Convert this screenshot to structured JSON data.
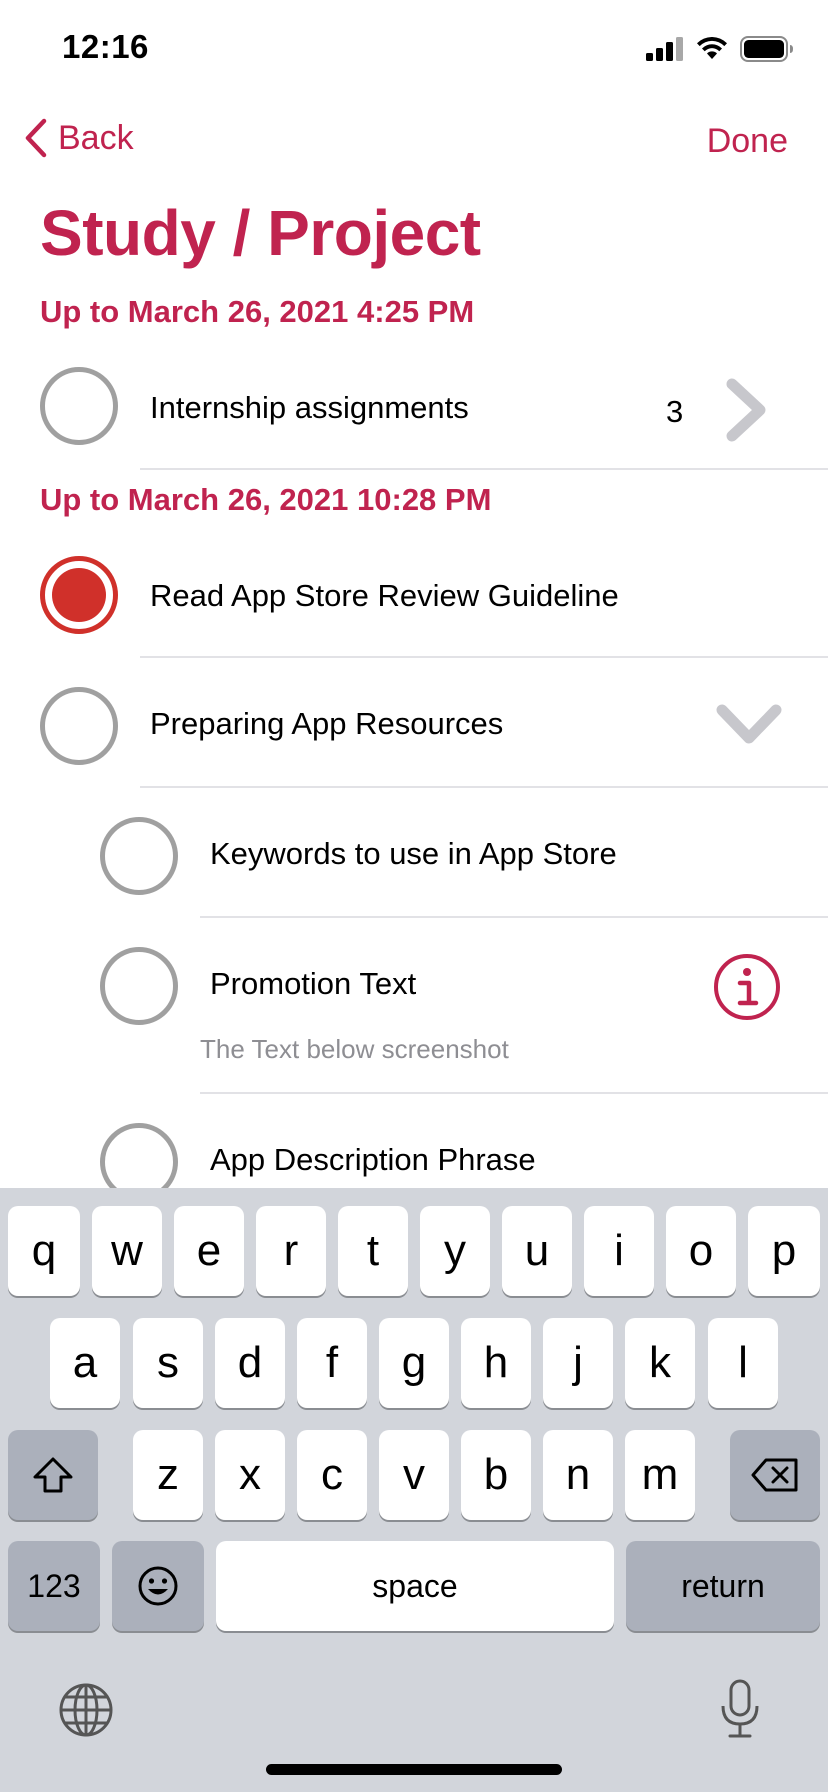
{
  "status_bar": {
    "time": "12:16"
  },
  "nav": {
    "back_label": "Back",
    "done_label": "Done"
  },
  "page_title": "Study / Project",
  "sections": [
    {
      "header": "Up to March 26, 2021 4:25 PM"
    },
    {
      "header": "Up to March 26, 2021 10:28 PM"
    }
  ],
  "items": [
    {
      "title": "Internship assignments",
      "count": "3",
      "accessory": "chevron-right-icon",
      "completed": false
    },
    {
      "title": "Read App Store Review Guideline",
      "completed": true
    },
    {
      "title": "Preparing App Resources",
      "accessory": "chevron-down-icon",
      "completed": false
    },
    {
      "title": "Keywords to use in App Store",
      "completed": false,
      "subtask": true
    },
    {
      "title": "Promotion Text",
      "note": "The Text below screenshot",
      "accessory": "info-icon",
      "completed": false,
      "subtask": true
    },
    {
      "title": "App Description Phrase",
      "completed": false,
      "subtask": true
    }
  ],
  "keyboard": {
    "row1": [
      "q",
      "w",
      "e",
      "r",
      "t",
      "y",
      "u",
      "i",
      "o",
      "p"
    ],
    "row2": [
      "a",
      "s",
      "d",
      "f",
      "g",
      "h",
      "j",
      "k",
      "l"
    ],
    "row3": [
      "z",
      "x",
      "c",
      "v",
      "b",
      "n",
      "m"
    ],
    "numbers_label": "123",
    "space_label": "space",
    "return_label": "return"
  },
  "colors": {
    "accent": "#c0234f",
    "completed": "#d0302a",
    "keyboard_bg": "#d2d5db"
  }
}
